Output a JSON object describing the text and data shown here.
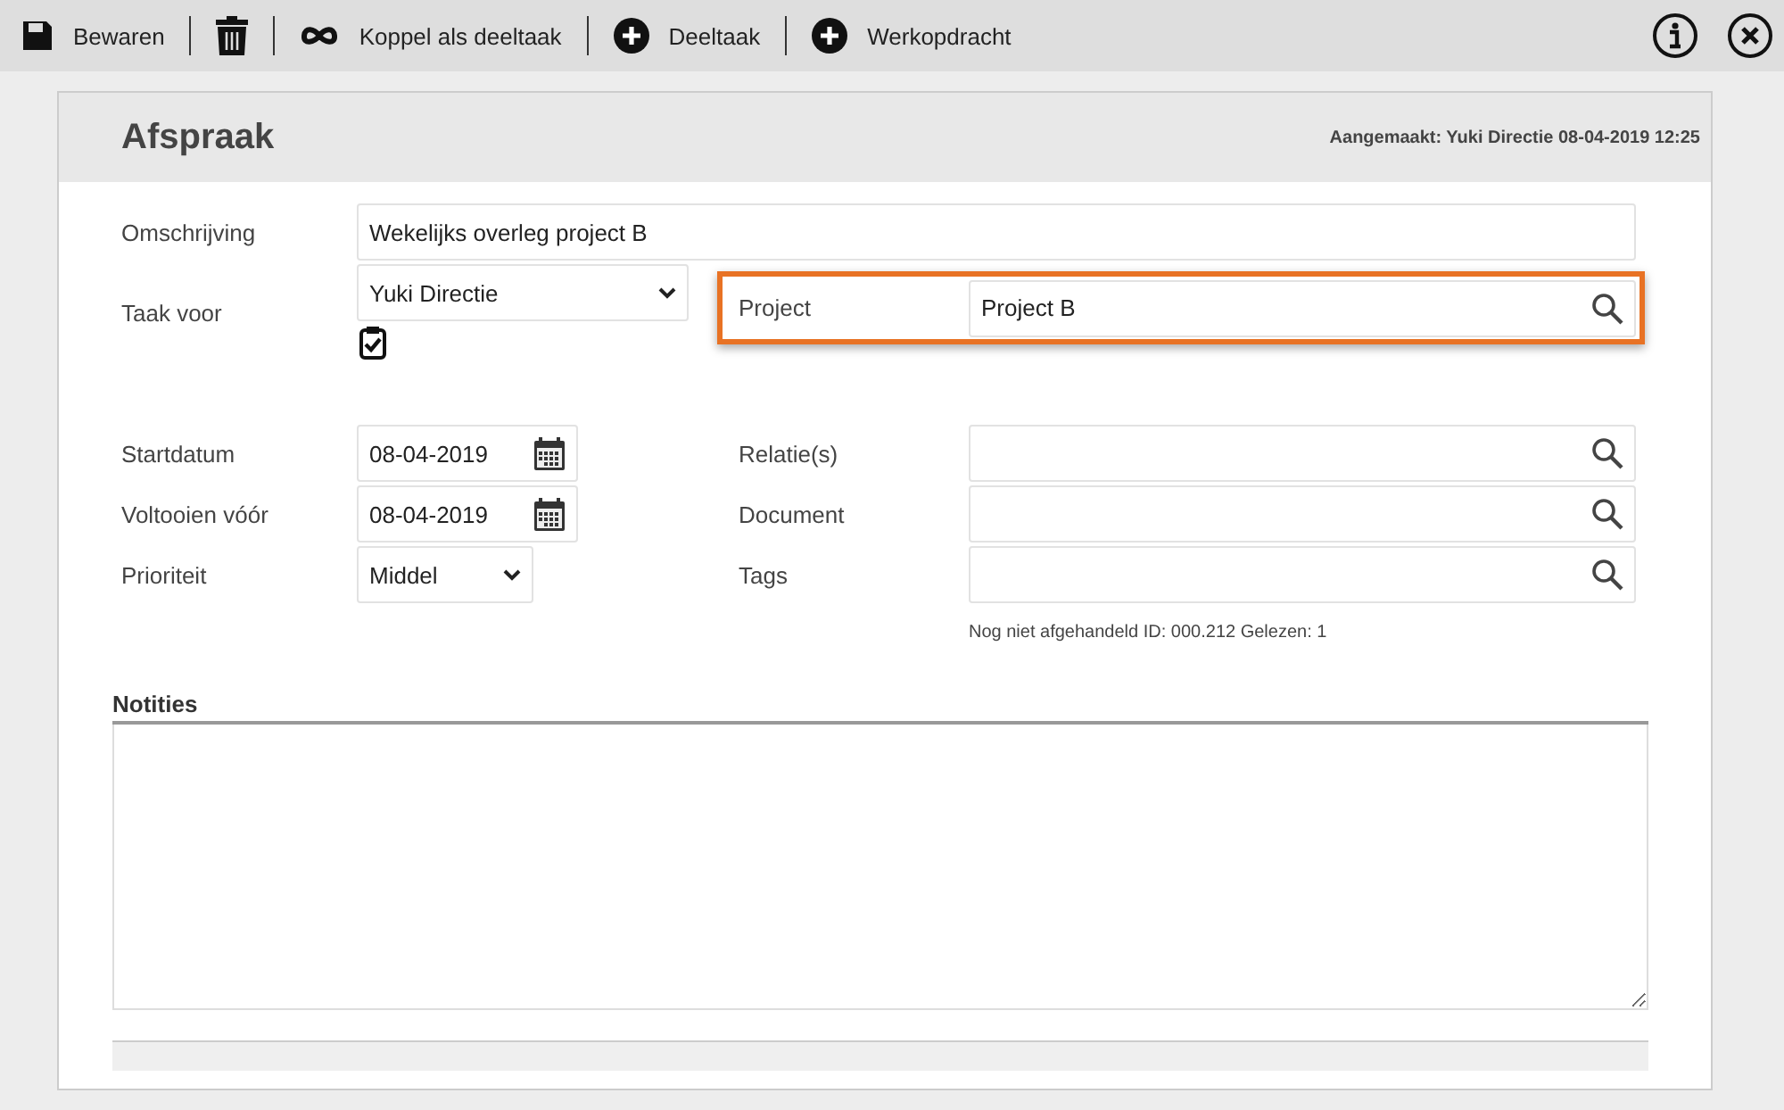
{
  "toolbar": {
    "left": [
      {
        "kind": "save",
        "label": "Bewaren"
      },
      {
        "kind": "trash"
      },
      {
        "kind": "link",
        "label": "Koppel als deeltaak"
      },
      {
        "kind": "add",
        "label": "Deeltaak"
      },
      {
        "kind": "add",
        "label": "Werkopdracht"
      }
    ],
    "right": [
      {
        "kind": "info"
      },
      {
        "kind": "close"
      }
    ]
  },
  "form": {
    "title": "Afspraak",
    "created": "Aangemaakt: Yuki Directie 08-04-2019 12:25",
    "description": {
      "label": "Omschrijving",
      "value": "Wekelijks overleg project B"
    },
    "assignee": {
      "label": "Taak voor",
      "value": "Yuki Directie"
    },
    "project": {
      "label": "Project",
      "value": "Project B",
      "highlighted": true
    },
    "left_fields": [
      {
        "kind": "date",
        "label": "Startdatum",
        "value": "08-04-2019"
      },
      {
        "kind": "date",
        "label": "Voltooien vóór",
        "value": "08-04-2019"
      },
      {
        "kind": "select",
        "label": "Prioriteit",
        "value": "Middel"
      }
    ],
    "right_fields": [
      {
        "label": "Relatie(s)"
      },
      {
        "label": "Document"
      },
      {
        "label": "Tags"
      }
    ],
    "status": "Nog niet afgehandeld ID: 000.212 Gelezen: 1",
    "notes_label": "Notities"
  }
}
